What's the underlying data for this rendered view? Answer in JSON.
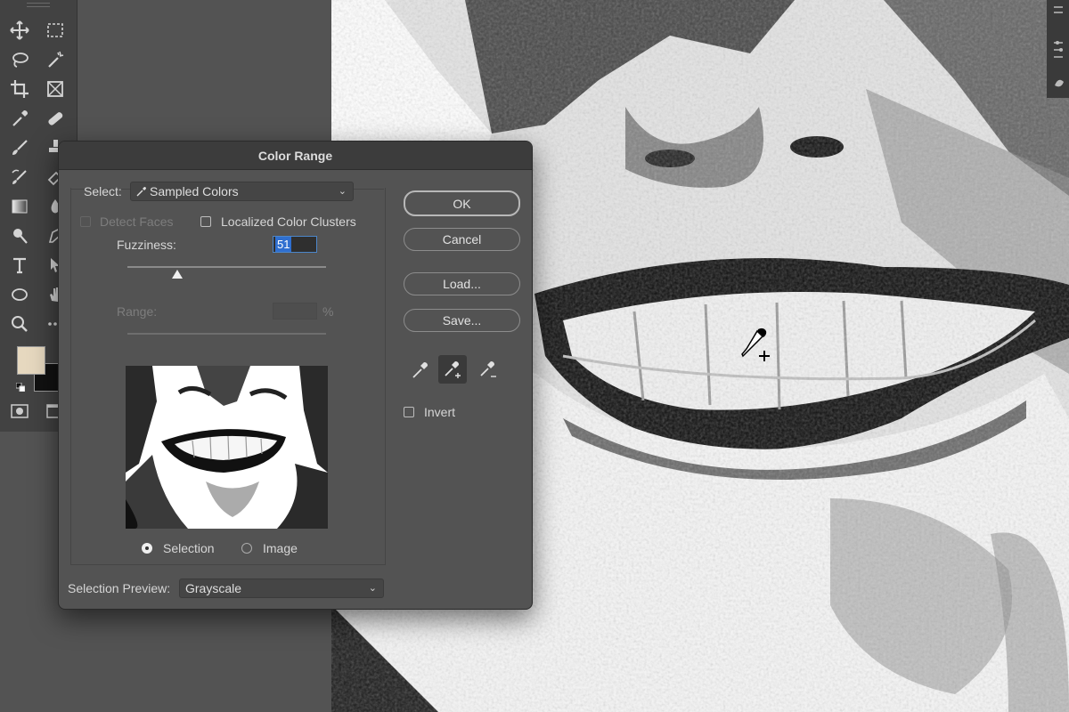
{
  "dialog": {
    "title": "Color Range",
    "select_label": "Select:",
    "select_value": "Sampled Colors",
    "detect_faces_label": "Detect Faces",
    "detect_faces_checked": false,
    "localized_clusters_label": "Localized Color Clusters",
    "localized_clusters_checked": false,
    "fuzziness_label": "Fuzziness:",
    "fuzziness_value": "51",
    "range_label": "Range:",
    "range_value": "",
    "range_unit": "%",
    "preview_modes": [
      {
        "label": "Selection",
        "selected": true
      },
      {
        "label": "Image",
        "selected": false
      }
    ],
    "selection_preview_label": "Selection Preview:",
    "selection_preview_value": "Grayscale",
    "buttons": {
      "ok": "OK",
      "cancel": "Cancel",
      "load": "Load...",
      "save": "Save..."
    },
    "eyedroppers": [
      "eyedropper-icon",
      "eyedropper-plus-icon",
      "eyedropper-minus-icon"
    ],
    "active_eyedropper": "eyedropper-plus-icon",
    "invert_label": "Invert",
    "invert_checked": false
  },
  "toolbar": {
    "tools": [
      "move-icon",
      "marquee-icon",
      "lasso-icon",
      "magic-wand-icon",
      "crop-icon",
      "frame-icon",
      "eyedropper-icon",
      "healing-icon",
      "brush-icon",
      "stamp-icon",
      "history-brush-icon",
      "eraser-icon",
      "gradient-icon",
      "blur-icon",
      "dodge-icon",
      "pen-icon",
      "type-icon",
      "path-select-icon",
      "ellipse-icon",
      "hand-icon",
      "zoom-icon",
      "more-icon"
    ],
    "foreground_color": "#e6d8bf",
    "background_color": "#111111"
  },
  "colors": {
    "dialog_bg": "#535353",
    "titlebar_bg": "#3c3c3c",
    "accent_selection": "#2f6fd0"
  }
}
